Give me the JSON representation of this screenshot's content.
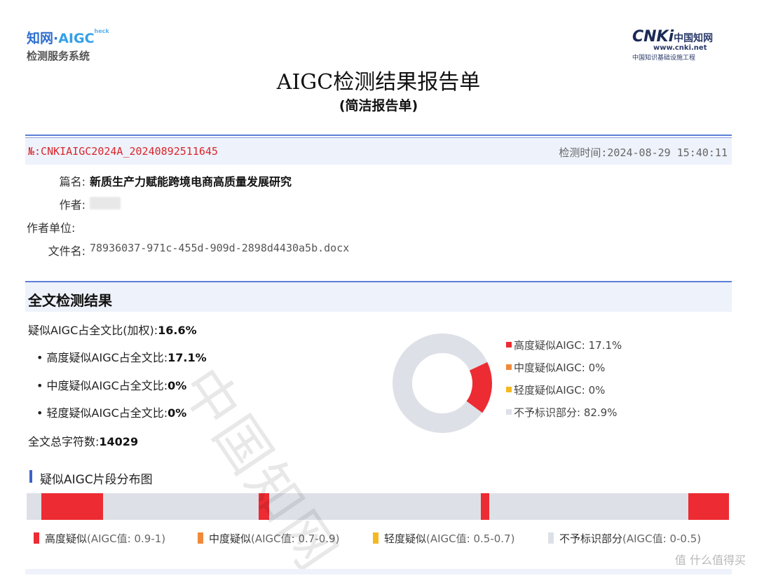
{
  "header": {
    "logo_left_line1_a": "知网·",
    "logo_left_line1_b": "AIGC",
    "logo_left_line1_sub": "heck",
    "logo_left_line2": "检测服务系统",
    "logo_right_brand": "CNKi",
    "logo_right_cn": "中国知网",
    "logo_right_url": "www.cnki.net",
    "logo_right_tag": "中国知识基础设施工程",
    "title": "AIGC检测结果报告单",
    "subtitle": "(简洁报告单)"
  },
  "info": {
    "report_no": "№:CNKIAIGC2024A_20240892511645",
    "check_time": "检测时间:2024-08-29 15:40:11",
    "title_label": "篇名:",
    "title_value": "新质生产力赋能跨境电商高质量发展研究",
    "author_label": "作者:",
    "author_value": "",
    "unit_label": "作者单位:",
    "unit_value": "",
    "file_label": "文件名:",
    "file_value": "78936037-971c-455d-909d-2898d4430a5b.docx"
  },
  "results": {
    "section_title": "全文检测结果",
    "weighted_label": "疑似AIGC占全文比(加权):",
    "weighted_value": "16.6%",
    "high_label": "• 高度疑似AIGC占全文比:",
    "high_value": "17.1%",
    "mid_label": "• 中度疑似AIGC占全文比:",
    "mid_value": "0%",
    "low_label": "• 轻度疑似AIGC占全文比:",
    "low_value": "0%",
    "chars_label": "全文总字符数:",
    "chars_value": "14029"
  },
  "chart_data": {
    "type": "pie",
    "categories": [
      "高度疑似AIGC",
      "中度疑似AIGC",
      "轻度疑似AIGC",
      "不予标识部分"
    ],
    "values": [
      17.1,
      0,
      0,
      82.9
    ],
    "legend_labels": [
      "高度疑似AIGC: 17.1%",
      "中度疑似AIGC: 0%",
      "轻度疑似AIGC: 0%",
      "不予标识部分: 82.9%"
    ],
    "colors": [
      "#ed2b33",
      "#f08a3a",
      "#f5b820",
      "#dde1e7"
    ],
    "legend": "right"
  },
  "distribution": {
    "title": "疑似AIGC片段分布图",
    "segments": [
      {
        "start": 0.021,
        "end": 0.109
      },
      {
        "start": 0.33,
        "end": 0.345
      },
      {
        "start": 0.647,
        "end": 0.659
      },
      {
        "start": 0.942,
        "end": 1.0
      }
    ],
    "legend": [
      {
        "name": "高度疑似",
        "range": "(AIGC值: 0.9-1)",
        "color": "#ed2b33"
      },
      {
        "name": "中度疑似",
        "range": "(AIGC值: 0.7-0.9)",
        "color": "#f08a3a"
      },
      {
        "name": "轻度疑似",
        "range": "(AIGC值: 0.5-0.7)",
        "color": "#f5b820"
      },
      {
        "name": "不予标识部分",
        "range": "(AIGC值: 0-0.5)",
        "color": "#dde1e7"
      }
    ]
  },
  "watermark": "中国知网",
  "site_watermark": "值 什么值得买"
}
